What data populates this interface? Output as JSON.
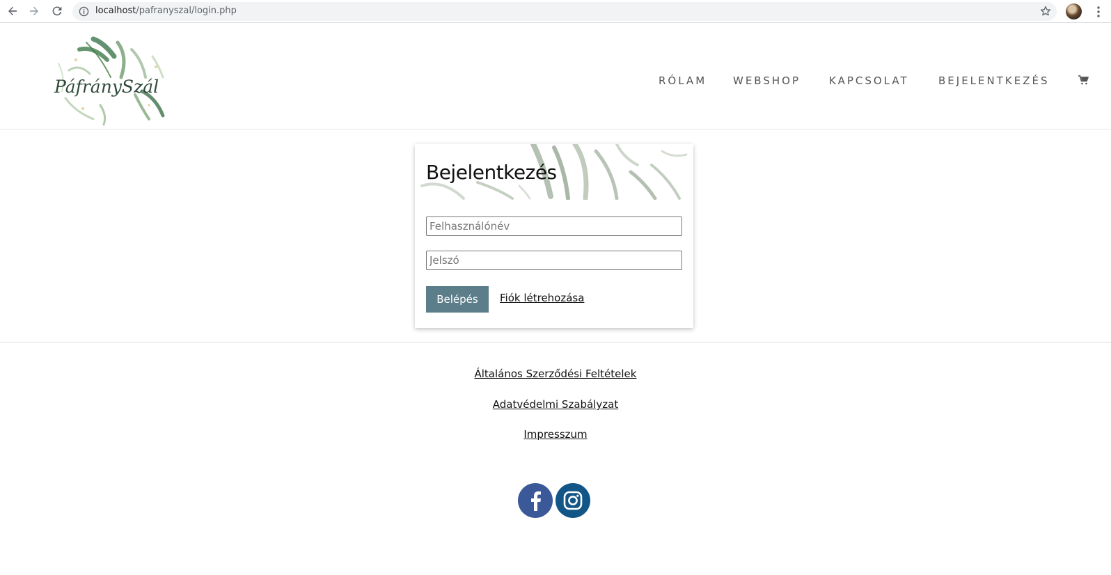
{
  "browser": {
    "url_host": "localhost",
    "url_path": "/pafranyszal/login.php"
  },
  "header": {
    "logo_text": "PáfránySzál",
    "nav": [
      {
        "label": "RÓLAM"
      },
      {
        "label": "WEBSHOP"
      },
      {
        "label": "KAPCSOLAT"
      },
      {
        "label": "BEJELENTKEZÉS"
      }
    ],
    "cart_icon": "shopping-cart-icon"
  },
  "login": {
    "title": "Bejelentkezés",
    "username_placeholder": "Felhasználónév",
    "username_value": "",
    "password_placeholder": "Jelszó",
    "password_value": "",
    "submit_label": "Belépés",
    "register_label": "Fiók létrehozása"
  },
  "footer": {
    "links": [
      {
        "label": "Általános Szerződési Feltételek"
      },
      {
        "label": "Adatvédelmi Szabályzat"
      },
      {
        "label": "Impresszum"
      }
    ],
    "social": [
      {
        "icon": "facebook-icon",
        "color": "#3b5998"
      },
      {
        "icon": "instagram-icon",
        "color": "#125688"
      }
    ]
  },
  "colors": {
    "button_bg": "#5c7d8a",
    "nav_text": "#555555"
  }
}
